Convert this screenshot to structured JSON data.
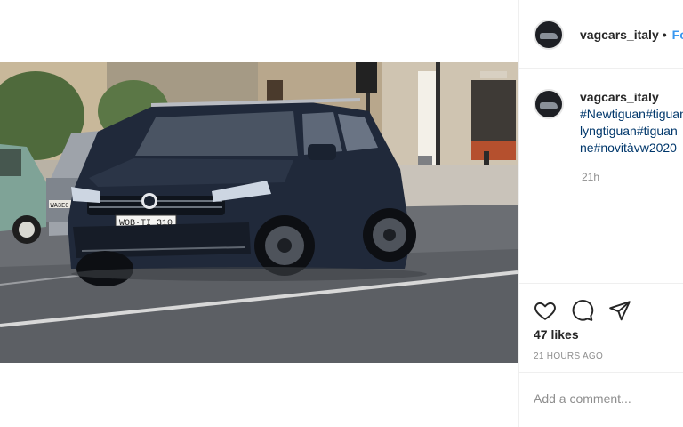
{
  "header": {
    "username": "vagcars_italy",
    "separator": "•",
    "follow_label": "Follow"
  },
  "caption": {
    "username": "vagcars_italy",
    "lines": [
      "#Newtiguan#tiguan",
      "lyngtiguan#tiguan",
      "ne#novitàvw2020"
    ],
    "time": "21h"
  },
  "actions": {
    "icons": [
      "heart-icon",
      "comment-icon",
      "share-icon"
    ],
    "likes": "47 likes",
    "time_ago": "21 HOURS AGO"
  },
  "comment": {
    "placeholder": "Add a comment..."
  },
  "media": {
    "plate": "WOB·TI 310",
    "plate_small": "WA3E0"
  }
}
